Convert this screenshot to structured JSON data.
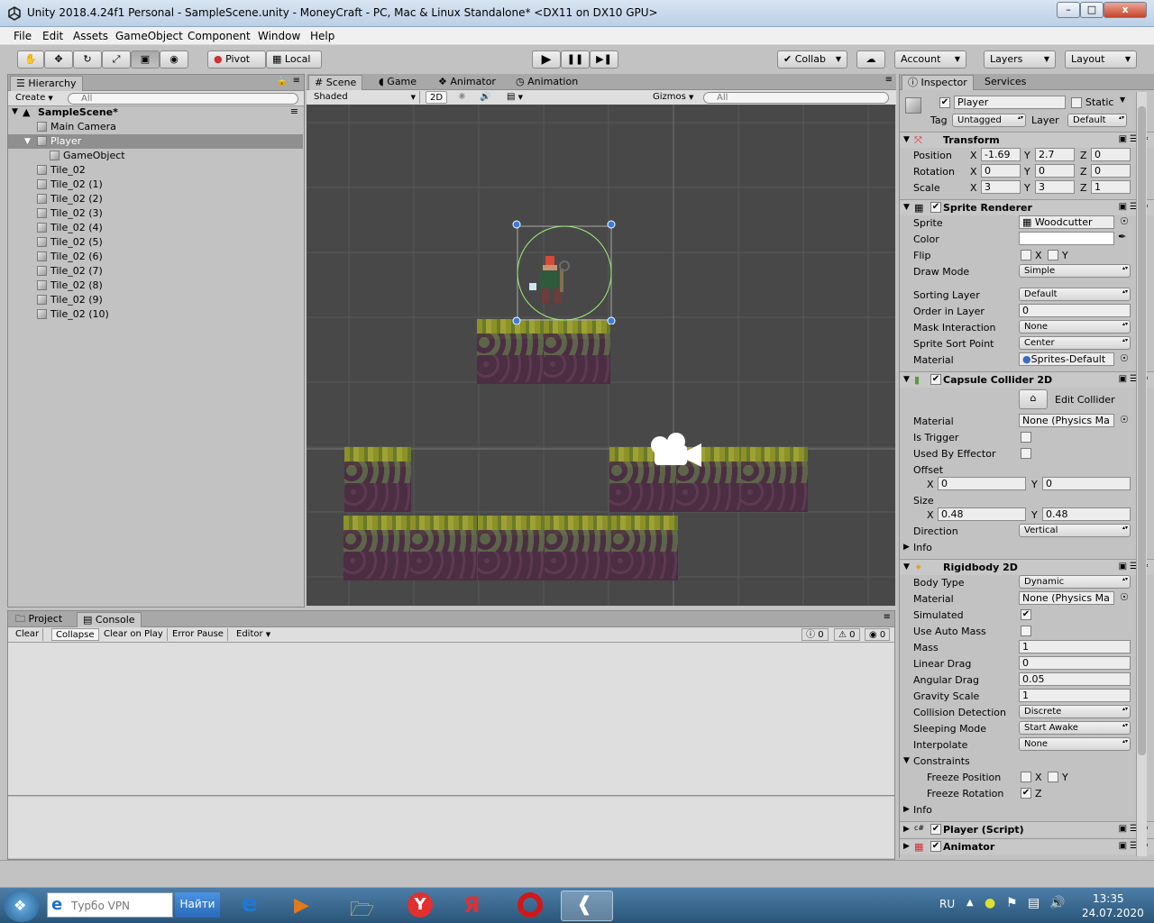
{
  "window": {
    "title": "Unity 2018.4.24f1 Personal - SampleScene.unity - MoneyCraft - PC, Mac & Linux Standalone* <DX11 on DX10 GPU>",
    "min_label": "–",
    "max_label": "□",
    "close_label": "x"
  },
  "menu": [
    "File",
    "Edit",
    "Assets",
    "GameObject",
    "Component",
    "Window",
    "Help"
  ],
  "toolbar": {
    "pivot": "Pivot",
    "local": "Local",
    "collab": "Collab",
    "account": "Account",
    "layers": "Layers",
    "layout": "Layout"
  },
  "hierarchy": {
    "tab": "Hierarchy",
    "create": "Create",
    "search_placeholder": "All",
    "scene": "SampleScene*",
    "items": [
      {
        "label": "Main Camera",
        "depth": 1
      },
      {
        "label": "Player",
        "depth": 1
      },
      {
        "label": "GameObject",
        "depth": 2
      },
      {
        "label": "Tile_02",
        "depth": 1
      },
      {
        "label": "Tile_02 (1)",
        "depth": 1
      },
      {
        "label": "Tile_02 (2)",
        "depth": 1
      },
      {
        "label": "Tile_02 (3)",
        "depth": 1
      },
      {
        "label": "Tile_02 (4)",
        "depth": 1
      },
      {
        "label": "Tile_02 (5)",
        "depth": 1
      },
      {
        "label": "Tile_02 (6)",
        "depth": 1
      },
      {
        "label": "Tile_02 (7)",
        "depth": 1
      },
      {
        "label": "Tile_02 (8)",
        "depth": 1
      },
      {
        "label": "Tile_02 (9)",
        "depth": 1
      },
      {
        "label": "Tile_02 (10)",
        "depth": 1
      }
    ]
  },
  "scene_tabs": {
    "scene": "Scene",
    "game": "Game",
    "animator": "Animator",
    "animation": "Animation",
    "shaded": "Shaded",
    "two_d": "2D",
    "gizmos": "Gizmos",
    "search_placeholder": "All"
  },
  "console": {
    "project_tab": "Project",
    "console_tab": "Console",
    "clear": "Clear",
    "collapse": "Collapse",
    "clear_on_play": "Clear on Play",
    "error_pause": "Error Pause",
    "editor": "Editor",
    "info_count": "0",
    "warn_count": "0",
    "error_count": "0"
  },
  "inspector": {
    "tab": "Inspector",
    "services_tab": "Services",
    "object_name": "Player",
    "static_label": "Static",
    "tag_label": "Tag",
    "tag_value": "Untagged",
    "layer_label": "Layer",
    "layer_value": "Default",
    "transform": {
      "title": "Transform",
      "position_label": "Position",
      "pos_x": "-1.69",
      "pos_y": "2.7",
      "pos_z": "0",
      "rotation_label": "Rotation",
      "rot_x": "0",
      "rot_y": "0",
      "rot_z": "0",
      "scale_label": "Scale",
      "scale_x": "3",
      "scale_y": "3",
      "scale_z": "1"
    },
    "sprite_renderer": {
      "title": "Sprite Renderer",
      "sprite_label": "Sprite",
      "sprite_value": "Woodcutter",
      "color_label": "Color",
      "flip_label": "Flip",
      "flip_x": "X",
      "flip_y": "Y",
      "draw_mode_label": "Draw Mode",
      "draw_mode_value": "Simple",
      "sorting_layer_label": "Sorting Layer",
      "sorting_layer_value": "Default",
      "order_label": "Order in Layer",
      "order_value": "0",
      "mask_label": "Mask Interaction",
      "mask_value": "None",
      "sort_point_label": "Sprite Sort Point",
      "sort_point_value": "Center",
      "material_label": "Material",
      "material_value": "Sprites-Default"
    },
    "capsule_collider": {
      "title": "Capsule Collider 2D",
      "edit_collider": "Edit Collider",
      "material_label": "Material",
      "material_value": "None (Physics Ma",
      "is_trigger_label": "Is Trigger",
      "used_by_effector_label": "Used By Effector",
      "offset_label": "Offset",
      "offset_x": "0",
      "offset_y": "0",
      "size_label": "Size",
      "size_x": "0.48",
      "size_y": "0.48",
      "direction_label": "Direction",
      "direction_value": "Vertical",
      "info_label": "Info"
    },
    "rigidbody": {
      "title": "Rigidbody 2D",
      "body_type_label": "Body Type",
      "body_type_value": "Dynamic",
      "material_label": "Material",
      "material_value": "None (Physics Ma",
      "simulated_label": "Simulated",
      "auto_mass_label": "Use Auto Mass",
      "mass_label": "Mass",
      "mass_value": "1",
      "linear_drag_label": "Linear Drag",
      "linear_drag_value": "0",
      "angular_drag_label": "Angular Drag",
      "angular_drag_value": "0.05",
      "gravity_label": "Gravity Scale",
      "gravity_value": "1",
      "collision_label": "Collision Detection",
      "collision_value": "Discrete",
      "sleeping_label": "Sleeping Mode",
      "sleeping_value": "Start Awake",
      "interpolate_label": "Interpolate",
      "interpolate_value": "None",
      "constraints_label": "Constraints",
      "freeze_pos_label": "Freeze Position",
      "freeze_rot_label": "Freeze Rotation",
      "x": "X",
      "y": "Y",
      "z": "Z",
      "info_label": "Info"
    },
    "player_script": {
      "title": "Player (Script)"
    },
    "animator": {
      "title": "Animator"
    }
  },
  "taskbar": {
    "search_placeholder": "Турбо VPN",
    "search_button": "Найти",
    "lang": "RU",
    "time": "13:35",
    "date": "24.07.2020"
  },
  "colors": {
    "scene_bg": "#484848",
    "panel_bg": "#c2c2c2",
    "grid_line": "#5a5a5a",
    "selection": "#8f8f8f",
    "collider": "#9cf07a",
    "handle": "#3b7be0"
  }
}
